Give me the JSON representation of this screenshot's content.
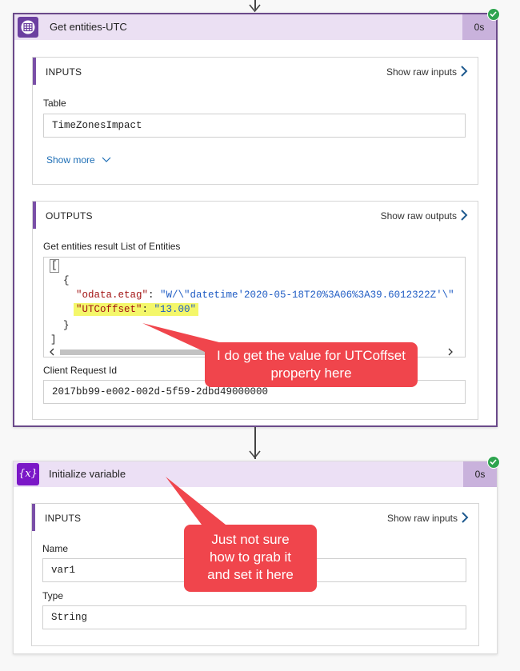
{
  "actions": [
    {
      "title": "Get entities-UTC",
      "duration": "0s",
      "status_icon": "check-circle-icon",
      "icon": "table-storage-icon",
      "inputs": {
        "label": "INPUTS",
        "show_raw": "Show raw inputs",
        "table_label": "Table",
        "table_value": "TimeZonesImpact",
        "show_more": "Show more"
      },
      "outputs": {
        "label": "OUTPUTS",
        "show_raw": "Show raw outputs",
        "result_label": "Get entities result List of Entities",
        "json": {
          "open_bracket": "[",
          "open_brace": "{",
          "etag_key": "\"odata.etag\"",
          "etag_value": "\"W/\\\"datetime'2020-05-18T20%3A06%3A39.6012322Z'\\\"",
          "utc_key": "\"UTCoffset\"",
          "utc_value": "\"13.00\"",
          "close_brace": "}",
          "close_bracket": "]"
        },
        "client_request_label": "Client Request Id",
        "client_request_value": "2017bb99-e002-002d-5f59-2dbd49000000"
      }
    },
    {
      "title": "Initialize variable",
      "duration": "0s",
      "status_icon": "check-circle-icon",
      "icon": "variable-icon",
      "icon_text": "{x}",
      "inputs": {
        "label": "INPUTS",
        "show_raw": "Show raw inputs",
        "name_label": "Name",
        "name_value": "var1",
        "type_label": "Type",
        "type_value": "String"
      }
    }
  ],
  "annotations": {
    "callout_1": "I do get the value for UTCoffset property here",
    "callout_2": "Just not sure how to grab it and set it here"
  },
  "colors": {
    "header_bg": "#ebe0f3",
    "duration_bg": "#c9b2dc",
    "accent_purple": "#7a4fa7",
    "callout": "#f0454c",
    "success": "#2ea44f",
    "link": "#1f6fb6"
  }
}
